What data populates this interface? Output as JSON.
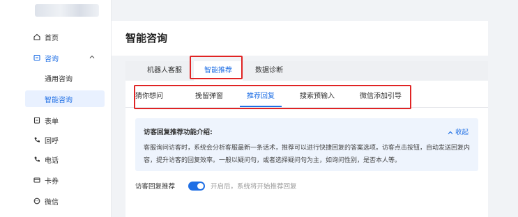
{
  "sidebar": {
    "items": [
      {
        "label": "首页",
        "icon": "home-icon"
      },
      {
        "label": "咨询",
        "icon": "chat-icon",
        "expanded": true
      },
      {
        "label": "表单",
        "icon": "form-icon"
      },
      {
        "label": "回呼",
        "icon": "callback-icon"
      },
      {
        "label": "电话",
        "icon": "phone-icon"
      },
      {
        "label": "卡券",
        "icon": "coupon-icon"
      },
      {
        "label": "微信",
        "icon": "wechat-icon"
      }
    ],
    "sub_items": [
      {
        "label": "通用咨询"
      },
      {
        "label": "智能咨询",
        "active": true
      }
    ]
  },
  "page": {
    "title": "智能咨询"
  },
  "tabs_primary": [
    {
      "label": "机器人客服"
    },
    {
      "label": "智能推荐",
      "active": true
    },
    {
      "label": "数据诊断"
    }
  ],
  "tabs_secondary": [
    {
      "label": "猜你想问"
    },
    {
      "label": "挽留弹窗"
    },
    {
      "label": "推荐回复",
      "active": true
    },
    {
      "label": "搜索预输入"
    },
    {
      "label": "微信添加引导"
    }
  ],
  "info": {
    "title": "访客回复推荐功能介绍:",
    "collapse_label": "收起",
    "text": "客服询问访客时，系统会分析客服最新一条话术，推荐可以进行快捷回复的答案选项。访客点击按钮，自动发送回复内容，提升访客的回复效率。一般以疑问句，或者选择疑问句为主，如询问性别，是否本人等。"
  },
  "reply_setting": {
    "label": "访客回复推荐",
    "enabled": true,
    "hint": "开启后，系统将开始推荐回复"
  },
  "colors": {
    "accent": "#1f6fe5",
    "highlight": "#e02424"
  }
}
